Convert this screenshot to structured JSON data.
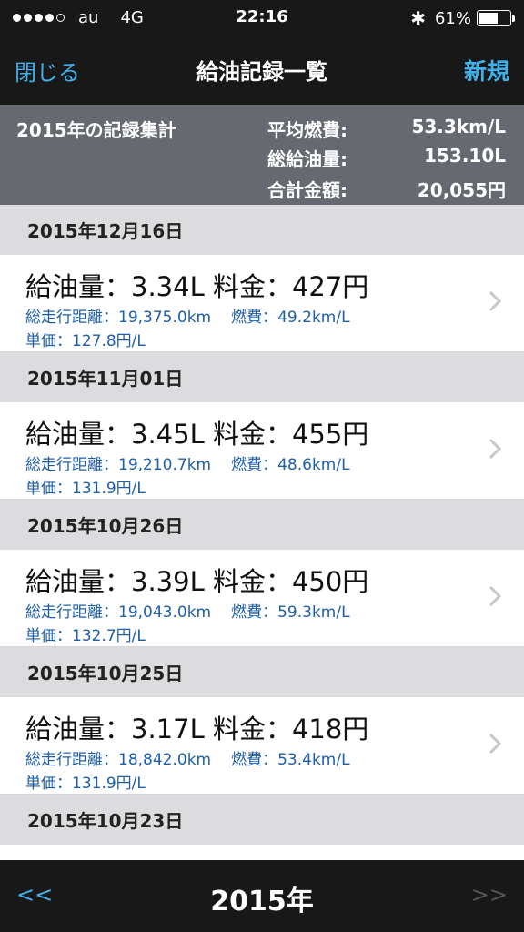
{
  "status_bar": {
    "carrier": "au",
    "network": "4G",
    "time": "22:16",
    "battery_text": "61%",
    "battery_level": 0.61,
    "signal_bars": 4,
    "bluetooth_icon": "bluetooth-icon"
  },
  "nav": {
    "close_label": "閉じる",
    "title": "給油記録一覧",
    "new_label": "新規"
  },
  "summary": {
    "year_label": "2015年の記録集計",
    "avg_label": "平均燃費:",
    "avg_value": "53.3km/L",
    "total_fuel_label": "総給油量:",
    "total_fuel_value": "153.10L",
    "total_cost_label": "合計金額:",
    "total_cost_value": "20,055円"
  },
  "records": [
    {
      "date": "2015年12月16日",
      "main": "給油量：3.34L 料金：427円",
      "distance": "総走行距離：19,375.0km",
      "efficiency": "燃費：49.2km/L",
      "unit_price": "単価：127.8円/L"
    },
    {
      "date": "2015年11月01日",
      "main": "給油量：3.45L 料金：455円",
      "distance": "総走行距離：19,210.7km",
      "efficiency": "燃費：48.6km/L",
      "unit_price": "単価：131.9円/L"
    },
    {
      "date": "2015年10月26日",
      "main": "給油量：3.39L 料金：450円",
      "distance": "総走行距離：19,043.0km",
      "efficiency": "燃費：59.3km/L",
      "unit_price": "単価：132.7円/L"
    },
    {
      "date": "2015年10月25日",
      "main": "給油量：3.17L 料金：418円",
      "distance": "総走行距離：18,842.0km",
      "efficiency": "燃費：53.4km/L",
      "unit_price": "単価：131.9円/L"
    },
    {
      "date": "2015年10月23日"
    }
  ],
  "footer": {
    "prev_label": "<<",
    "year": "2015年",
    "next_label": ">>"
  },
  "colors": {
    "accent": "#3fb0e8",
    "detail_text": "#1f5fa8",
    "summary_bg": "#666a70",
    "bar_bg": "#181818"
  }
}
